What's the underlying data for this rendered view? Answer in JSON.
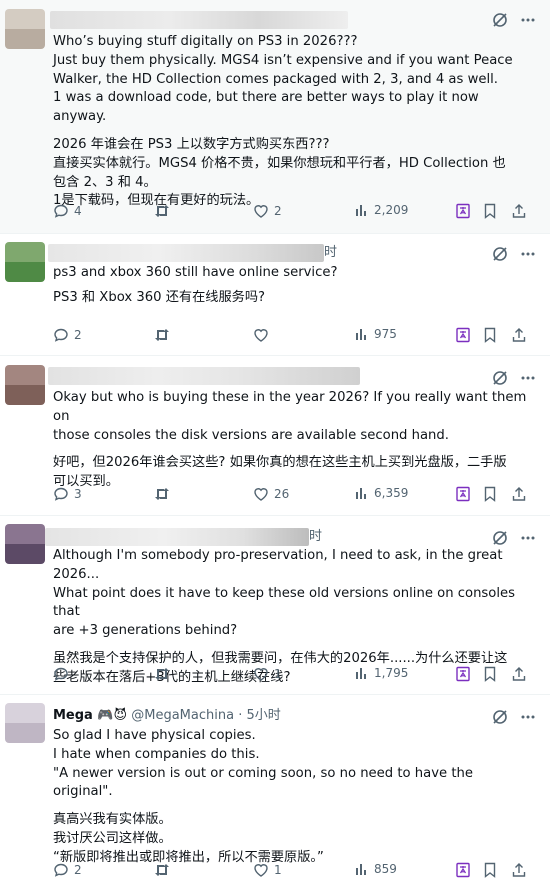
{
  "posts": [
    {
      "author": {
        "name": "",
        "handle": "",
        "time": ""
      },
      "lines_en": [
        "Who’s buying stuff digitally on PS3 in 2026???",
        "Just buy them physically. MGS4 isn’t expensive and if you want Peace",
        "Walker, the HD Collection comes packaged with 2, 3, and 4 as well.",
        "1 was a download code, but there are better ways to play it now anyway."
      ],
      "lines_zh": [
        "2026 年谁会在 PS3 上以数字方式购买东西???",
        "直接买实体就行。MGS4 价格不贵，如果你想玩和平行者，HD Collection 也",
        "包含 2、3 和 4。",
        "1是下载码，但现在有更好的玩法。"
      ],
      "stats": {
        "replies": "4",
        "reposts": "",
        "likes": "2",
        "views": "2,209"
      }
    },
    {
      "author": {
        "name": "",
        "handle": "",
        "time": "时"
      },
      "lines_en": [
        "ps3 and xbox 360 still have online service?"
      ],
      "lines_zh": [
        "PS3 和 Xbox 360 还有在线服务吗?"
      ],
      "stats": {
        "replies": "2",
        "reposts": "",
        "likes": "",
        "views": "975"
      }
    },
    {
      "author": {
        "name": "",
        "handle": "",
        "time": ""
      },
      "lines_en": [
        "Okay but who is buying these in the year 2026? If you really want them on",
        "those consoles the disk versions are available second hand."
      ],
      "lines_zh": [
        "好吧，但2026年谁会买这些? 如果你真的想在这些主机上买到光盘版，二手版",
        "可以买到。"
      ],
      "stats": {
        "replies": "3",
        "reposts": "",
        "likes": "26",
        "views": "6,359"
      }
    },
    {
      "author": {
        "name": "",
        "handle": "",
        "time": "时"
      },
      "lines_en": [
        "Although I'm somebody pro-preservation, I need to ask, in the great 2026...",
        "What point does it have to keep these old versions online on consoles that",
        "are +3 generations behind?"
      ],
      "lines_zh": [
        "虽然我是个支持保护的人，但我需要问，在伟大的2026年......为什么还要让这",
        "些老版本在落后+3代的主机上继续在线?"
      ],
      "stats": {
        "replies": "",
        "reposts": "",
        "likes": "1",
        "views": "1,795"
      }
    },
    {
      "author": {
        "name": "Mega 🎮😈",
        "handle": "@MegaMachina",
        "time": "· 5小时"
      },
      "lines_en": [
        "So glad I have physical copies.",
        "I hate when companies do this.",
        "\"A newer version is out or coming soon, so no need to have the original\"."
      ],
      "lines_zh": [
        "真高兴我有实体版。",
        "我讨厌公司这样做。",
        "“新版即将推出或即将推出，所以不需要原版。”"
      ],
      "stats": {
        "replies": "2",
        "reposts": "",
        "likes": "1",
        "views": "859"
      }
    }
  ],
  "colors": {
    "text": "#0f1419",
    "muted": "#536471",
    "accent": "#7b2fbf",
    "separator": "#eff3f4"
  },
  "icons": [
    "grok-icon",
    "more-icon",
    "reply-icon",
    "repost-icon",
    "like-icon",
    "views-icon",
    "grok-translate-icon",
    "bookmark-icon",
    "share-icon"
  ]
}
